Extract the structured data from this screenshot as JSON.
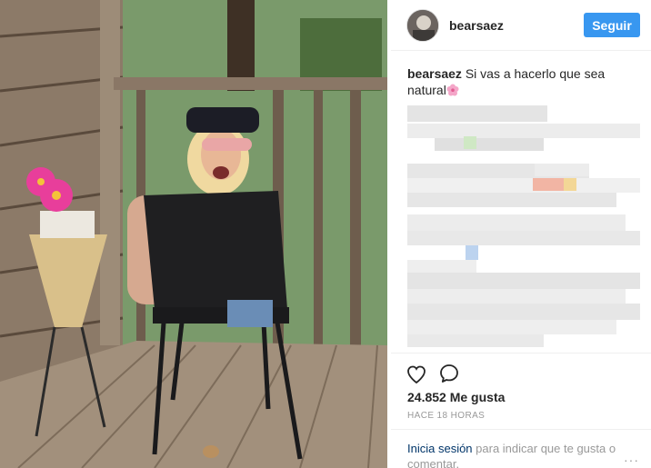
{
  "header": {
    "username": "bearsaez",
    "follow_label": "Seguir"
  },
  "caption": {
    "author": "bearsaez",
    "text": " Si vas a hacerlo que sea natural"
  },
  "actions": {
    "like_icon": "heart-icon",
    "comment_icon": "comment-icon"
  },
  "stats": {
    "likes": "24.852 Me gusta",
    "time": "HACE 18 HORAS"
  },
  "login": {
    "link": "Inicia sesión",
    "text": " para indicar que te gusta o comentar.",
    "more": "···"
  },
  "colors": {
    "accent": "#3897f0",
    "link": "#003569",
    "muted": "#999999"
  }
}
